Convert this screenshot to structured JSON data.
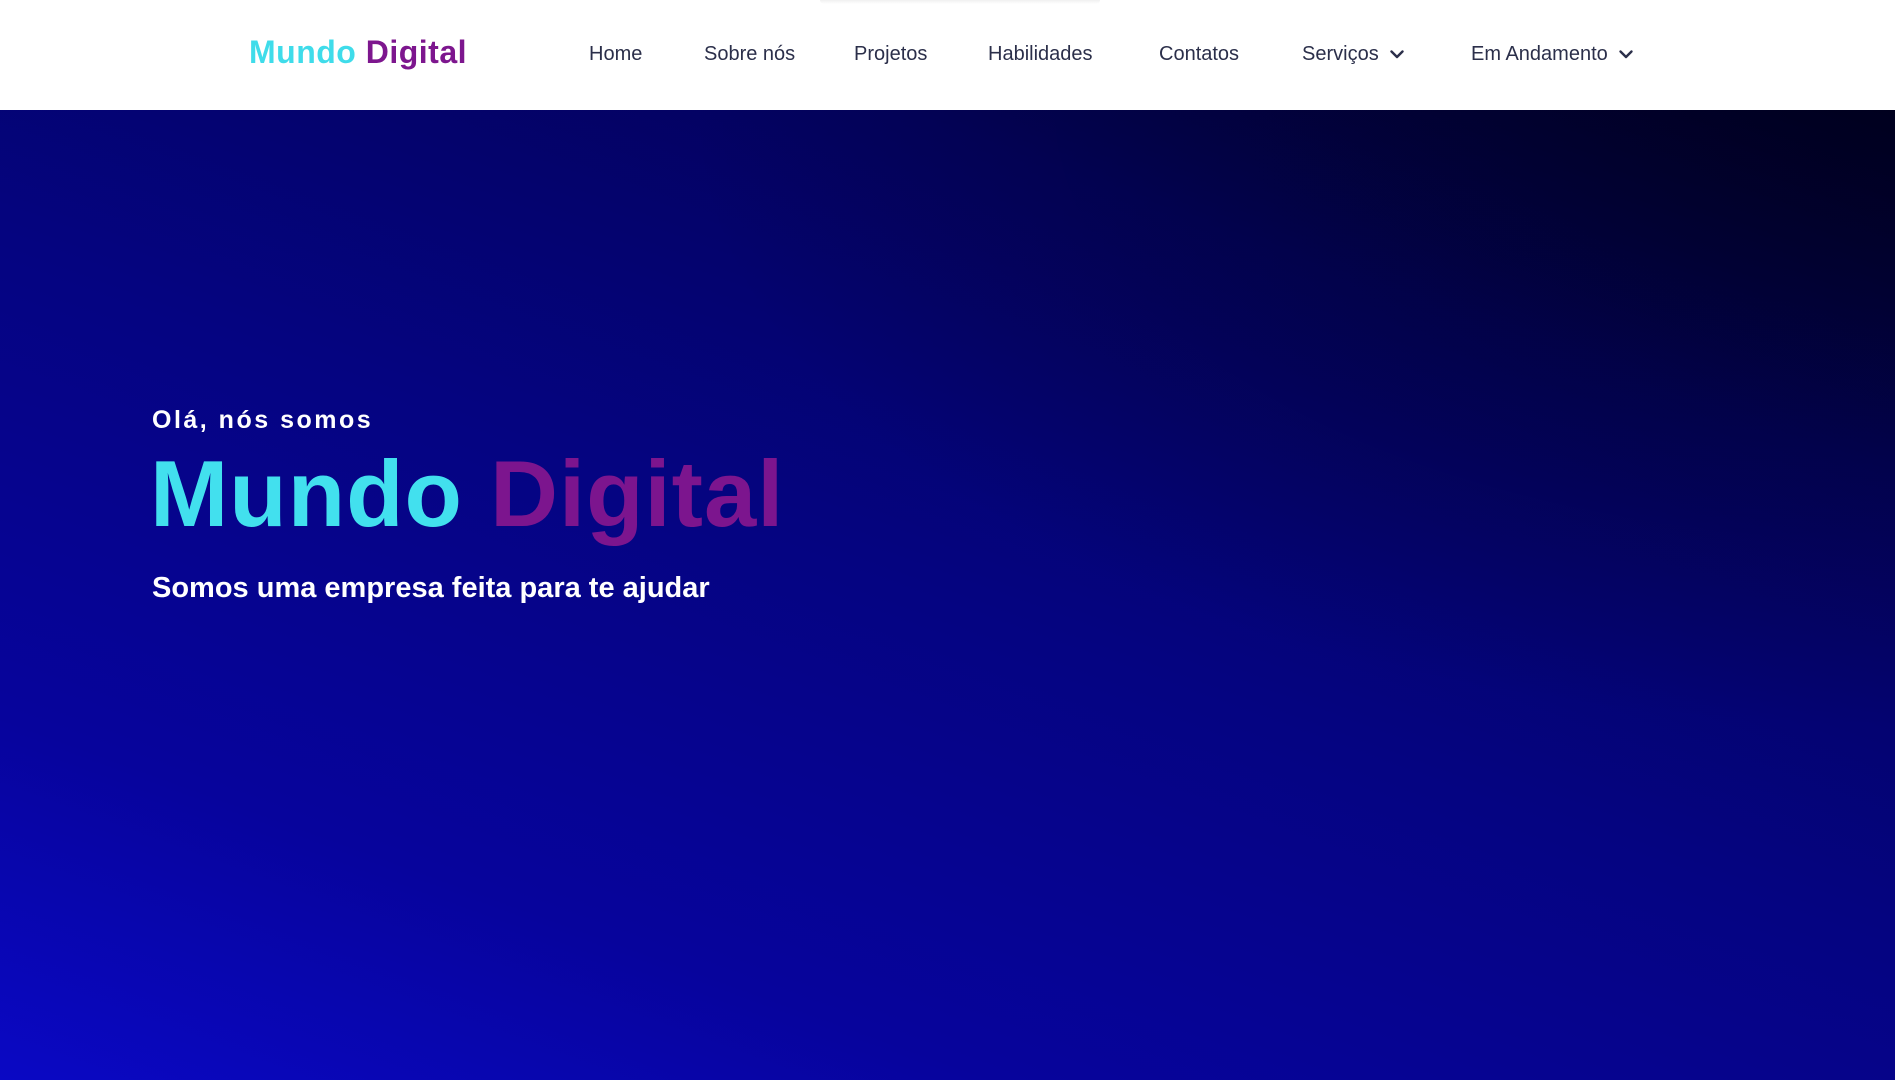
{
  "header": {
    "logo": {
      "word1": "Mundo",
      "word2": "Digital"
    },
    "nav": [
      {
        "label": "Home"
      },
      {
        "label": "Sobre nós"
      },
      {
        "label": "Projetos"
      },
      {
        "label": "Habilidades"
      },
      {
        "label": "Contatos"
      },
      {
        "label": "Serviços",
        "icon": "chevron-down-icon"
      },
      {
        "label": "Em Andamento",
        "icon": "chevron-down-icon"
      }
    ]
  },
  "hero": {
    "greeting": "Olá, nós somos",
    "title": {
      "word1": "Mundo",
      "word2": "Digital"
    },
    "tagline": "Somos uma empresa feita para te ajudar"
  },
  "colors": {
    "accent_cyan": "#42e0ee",
    "accent_purple": "#7c158e",
    "nav_text": "#2b2f4a",
    "hero_dark": "#00002b",
    "hero_blue": "#0a08c4"
  }
}
